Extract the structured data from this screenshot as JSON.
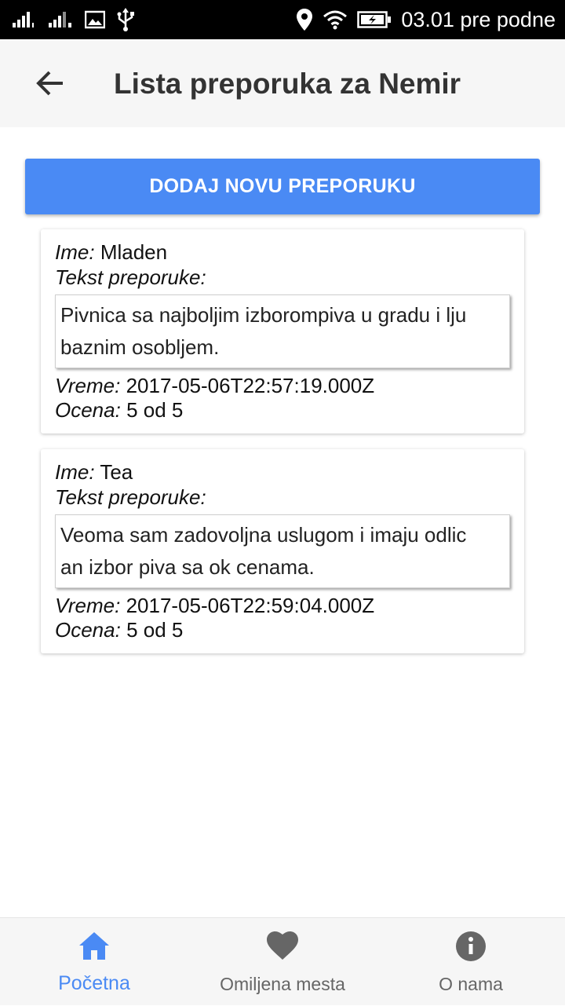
{
  "status_bar": {
    "time": "03.01 pre podne"
  },
  "header": {
    "title": "Lista preporuka za Nemir"
  },
  "add_button_label": "DODAJ NOVU PREPORUKU",
  "labels": {
    "name": "Ime:",
    "text": "Tekst preporuke:",
    "time": "Vreme:",
    "rating": "Ocena:"
  },
  "recommendations": [
    {
      "name": "Mladen",
      "text_line1": "Pivnica sa najboljim izborompiva u gradu i lju",
      "text_line2": "baznim osobljem.",
      "time": "2017-05-06T22:57:19.000Z",
      "rating": "5 od 5"
    },
    {
      "name": "Tea",
      "text_line1": "Veoma sam zadovoljna uslugom i imaju odlic",
      "text_line2": "an izbor piva sa ok cenama.",
      "time": "2017-05-06T22:59:04.000Z",
      "rating": "5 od 5"
    }
  ],
  "bottom_nav": {
    "active_color": "#4a8af4",
    "inactive_color": "#666666",
    "items": [
      {
        "label": "Početna",
        "icon": "home-icon",
        "active": true
      },
      {
        "label": "Omiljena mesta",
        "icon": "heart-icon",
        "active": false
      },
      {
        "label": "O nama",
        "icon": "info-icon",
        "active": false
      }
    ]
  }
}
